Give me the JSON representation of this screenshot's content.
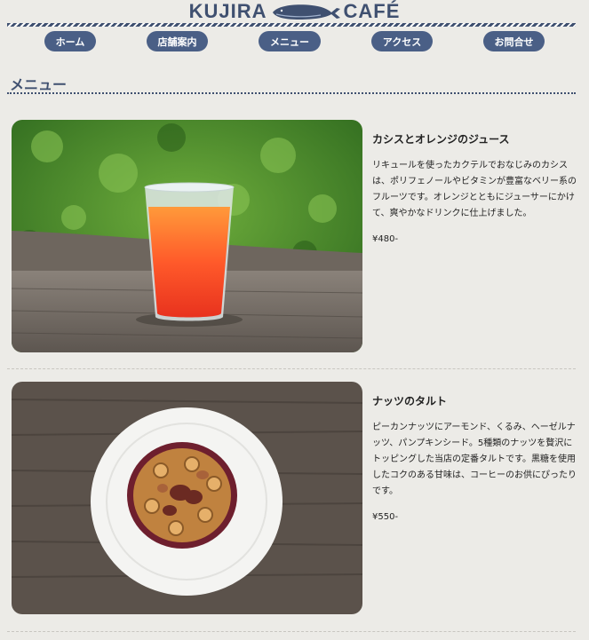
{
  "header": {
    "logo_left": "KUJIRA",
    "logo_right": "CAFÉ",
    "logo_icon": "whale-icon"
  },
  "nav": {
    "items": [
      {
        "label": "ホーム"
      },
      {
        "label": "店舗案内"
      },
      {
        "label": "メニュー"
      },
      {
        "label": "アクセス"
      },
      {
        "label": "お問合せ"
      }
    ]
  },
  "main": {
    "section_title": "メニュー",
    "items": [
      {
        "name": "カシスとオレンジのジュース",
        "description": "リキュールを使ったカクテルでおなじみのカシスは、ポリフェノールやビタミンが豊富なベリー系のフルーツです。オレンジとともにジューサーにかけて、爽やかなドリンクに仕上げました。",
        "price": "¥480-",
        "photo": "orange-juice-photo"
      },
      {
        "name": "ナッツのタルト",
        "description": "ピーカンナッツにアーモンド、くるみ、ヘーゼルナッツ、パンプキンシード。5種類のナッツを贅沢にトッピングした当店の定番タルトです。黒糖を使用したコクのある甘味は、コーヒーのお供にぴったりです。",
        "price": "¥550-",
        "photo": "nut-tart-photo"
      }
    ]
  },
  "colors": {
    "brand": "#3f5070",
    "nav_button": "#4a5f86",
    "background": "#ecebe7"
  }
}
